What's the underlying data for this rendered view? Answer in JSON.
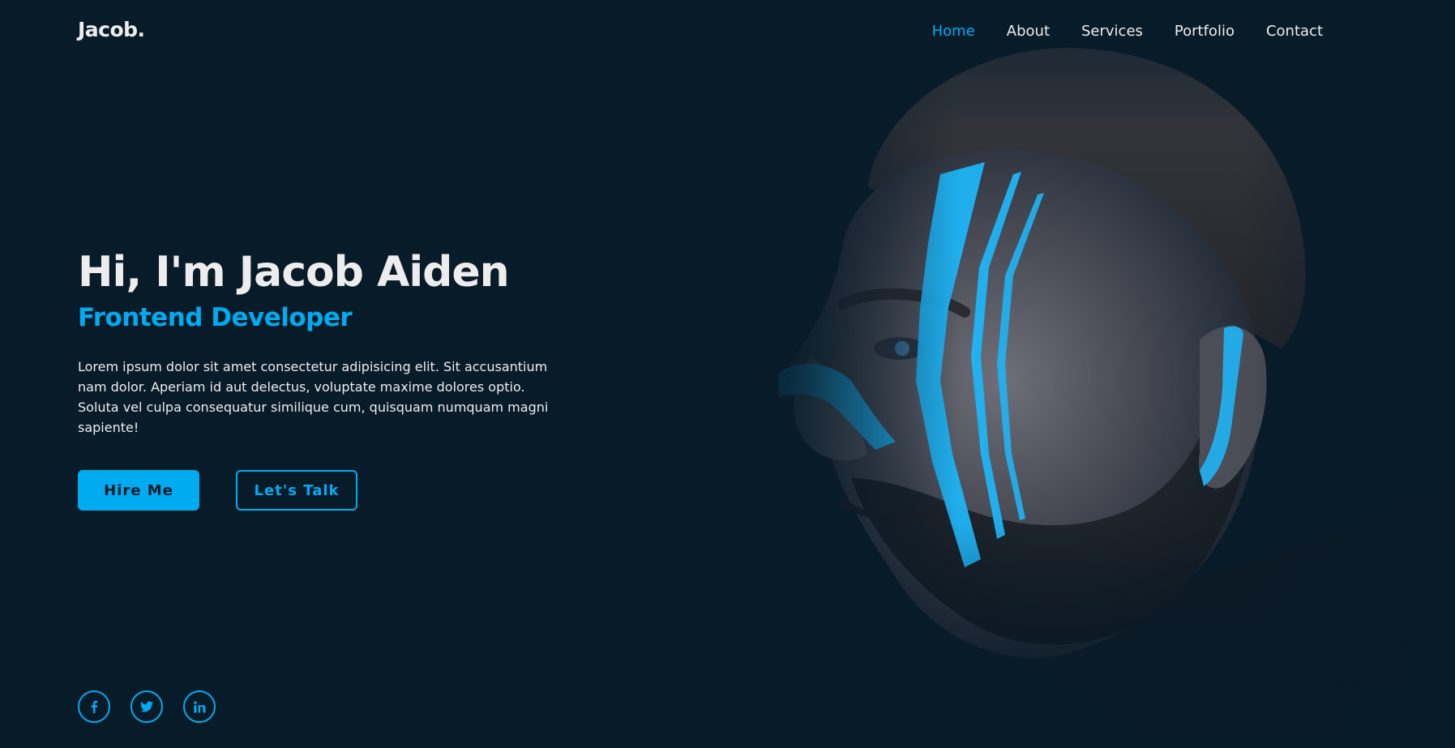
{
  "colors": {
    "background": "#081b29",
    "accent": "#00abf0",
    "text": "#ededed"
  },
  "header": {
    "logo": "Jacob.",
    "nav": [
      {
        "label": "Home",
        "active": true
      },
      {
        "label": "About",
        "active": false
      },
      {
        "label": "Services",
        "active": false
      },
      {
        "label": "Portfolio",
        "active": false
      },
      {
        "label": "Contact",
        "active": false
      }
    ]
  },
  "hero": {
    "title": "Hi, I'm Jacob Aiden",
    "subtitle": "Frontend Developer",
    "description": "Lorem ipsum dolor sit amet consectetur adipisicing elit. Sit accusantium nam dolor. Aperiam id aut delectus, voluptate maxime dolores optio. Soluta vel culpa consequatur similique cum, quisquam numquam magni sapiente!",
    "buttons": {
      "primary": "Hire Me",
      "secondary": "Let's Talk"
    }
  },
  "social": [
    {
      "icon": "facebook-icon"
    },
    {
      "icon": "twitter-icon"
    },
    {
      "icon": "linkedin-icon"
    }
  ],
  "image": {
    "subject": "portrait-photo",
    "paint_color": "#1fb4f5"
  }
}
